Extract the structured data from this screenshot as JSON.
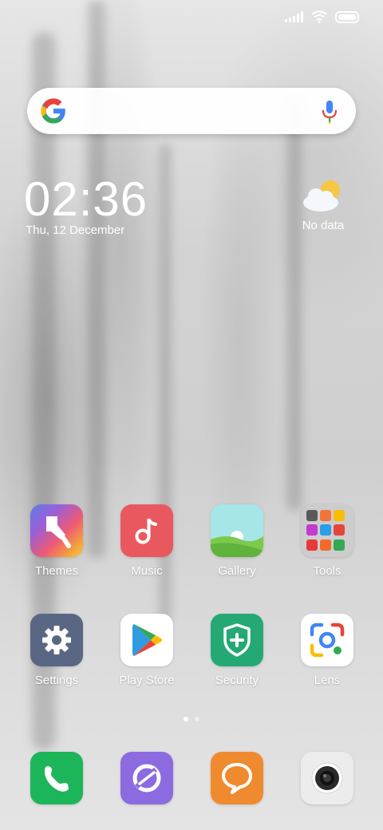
{
  "status_bar": {
    "signal_icon": "signal-icon",
    "wifi_icon": "wifi-icon",
    "battery_icon": "battery-icon"
  },
  "search": {
    "logo_icon": "google-g-icon",
    "mic_icon": "mic-icon"
  },
  "clock": {
    "time": "02:36",
    "date": "Thu, 12 December"
  },
  "weather": {
    "icon": "partly-cloudy-icon",
    "text": "No data"
  },
  "apps": [
    {
      "label": "Themes",
      "icon": "themes-icon"
    },
    {
      "label": "Music",
      "icon": "music-icon"
    },
    {
      "label": "Gallery",
      "icon": "gallery-icon"
    },
    {
      "label": "Tools",
      "icon": "folder-icon"
    },
    {
      "label": "Settings",
      "icon": "gear-icon"
    },
    {
      "label": "Play Store",
      "icon": "play-store-icon"
    },
    {
      "label": "Security",
      "icon": "shield-plus-icon"
    },
    {
      "label": "Lens",
      "icon": "lens-icon"
    }
  ],
  "page_indicator": {
    "pages": 2,
    "current": 1
  },
  "dock": [
    {
      "icon": "phone-icon",
      "color": "#1db55a"
    },
    {
      "icon": "browser-icon",
      "color": "#8c6be0"
    },
    {
      "icon": "messages-icon",
      "color": "#f08a2e"
    },
    {
      "icon": "camera-icon",
      "color": "#ececec"
    }
  ]
}
